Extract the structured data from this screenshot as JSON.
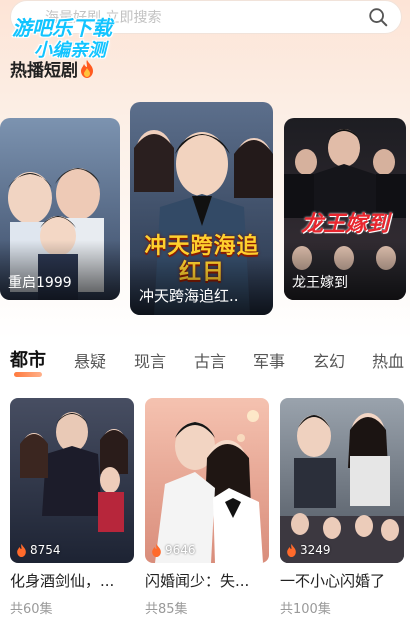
{
  "search": {
    "placeholder": "海量好剧 立即搜索"
  },
  "watermark": {
    "line1": "游吧乐下载",
    "line2": "小编亲测"
  },
  "hot_section": {
    "title": "热播短剧"
  },
  "hot_cards": [
    {
      "title": "重启1999"
    },
    {
      "title": "冲天跨海追红..",
      "poster_text": "冲天跨海追红日"
    },
    {
      "title": "龙王嫁到",
      "poster_text": "龙王嫁到"
    }
  ],
  "tabs": [
    "都市",
    "悬疑",
    "现言",
    "古言",
    "军事",
    "玄幻",
    "热血"
  ],
  "grid": [
    {
      "title": "化身酒剑仙，...",
      "views": "8754",
      "episodes": "共60集"
    },
    {
      "title": "闪婚闻少：失...",
      "views": "9646",
      "episodes": "共85集"
    },
    {
      "title": "一不小心闪婚了",
      "views": "3249",
      "episodes": "共100集"
    }
  ],
  "colors": {
    "accent": "#ff7a3d",
    "watermark": "#12c4ff"
  }
}
